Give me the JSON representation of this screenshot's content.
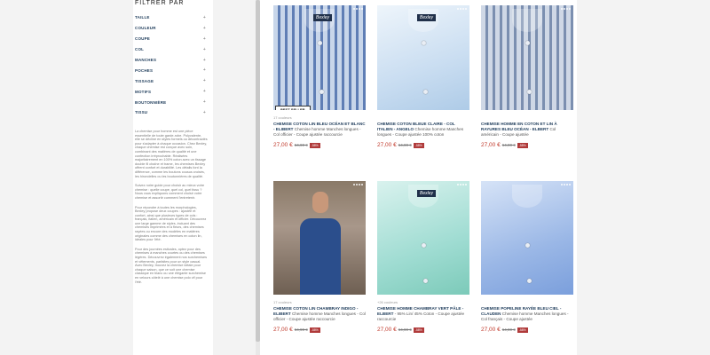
{
  "filters": {
    "title": "FILTRER PAR",
    "items": [
      "TAILLE",
      "COULEUR",
      "COUPE",
      "COL",
      "MANCHES",
      "POCHES",
      "TISSAGE",
      "MOTIFS",
      "BOUTONNIÈRE",
      "TISSU"
    ],
    "toggle_symbol": "+"
  },
  "description": [
    "La chemise pour homme est une pièce essentielle de toute garde-robe. Polyvalente, elle se décline en styles formels ou décontractés pour s'adapter à chaque occasion. Chez Bexley, chaque chemise est conçue avec soin, combinant des matières de qualité et une confection irréprochable. Réalisées majoritairement en 100% coton avec un tissage double fil chaîne et trame, les chemises Bexley offrent confort et durabilité. Les détails font la différence, comme les boutons cousus croisés, les hirondelles ou les boutonnières de qualité.",
    "Suivez notre guide pour choisir au mieux votre chemise : quelle coupe, quel col, quel tissu ? Nous vous expliquons comment choisir votre chemise et assortir comment l'entretenir.",
    "Pour répondre à toutes les morphologies, Bexley propose deux coupes : ajustée et confort, ainsi que plusieurs types de cols : français, italien, américain et officier. Découvrez une large gamme de styles, incluant des chemises imprimées et à fleurs, des chemises rayées ou encore des modèles en matières originales comme des chemises en coton lin, idéales pour l'été.",
    "Pour des journées estivales, optez pour des chemises à manches courtes ou des chemises légères. Découvrez également nos surchemises et vêtements, parfaites pour un style casual. Avec Bexley, trouvez la chemise idéale pour chaque saison, que ce soit une chemise classique en blanc ou une élégante surchemise en velours côtelé à une chemise polo vif pour l'été."
  ],
  "products": [
    {
      "colors": "17 couleurs",
      "badge": "BEST SELLER",
      "title": "CHEMISE COTON LIN BLEU OCÉAN ET BLANC - ELIBERT",
      "subtitle": "Chemise homme Manches longues - Col officier - Coupe ajustée raccourcie",
      "price": "27,00 €",
      "old_price": "64,90 €",
      "promo": "-58%",
      "brand": "Bexley",
      "image": "stripes-blue"
    },
    {
      "colors": "",
      "badge": "",
      "title": "CHEMISE COTON BLEUE CLAIRE - COL ITALIEN - ANGELO",
      "subtitle": "Chemise homme Manches longues - Coupe ajustée 100% coton",
      "price": "27,00 €",
      "old_price": "64,90 €",
      "promo": "-58%",
      "brand": "Bexley",
      "image": "solid-light"
    },
    {
      "colors": "",
      "badge": "",
      "title": "CHEMISE HOMME EN COTON ET LIN À RAYURES BLEU OCÉAN - ELBERT",
      "subtitle": "Col américain - Coupe ajustée",
      "price": "27,00 €",
      "old_price": "64,90 €",
      "promo": "-58%",
      "brand": "",
      "image": "stripes-grey"
    },
    {
      "colors": "17 couleurs",
      "badge": "",
      "title": "CHEMISE COTON LIN CHAMBRAY INDIGO - ELIBERT",
      "subtitle": "Chemise homme Manches longues - Col officier - Coupe ajustée raccourcie",
      "price": "27,00 €",
      "old_price": "64,90 €",
      "promo": "-58%",
      "brand": "",
      "image": "model"
    },
    {
      "colors": "+26 couleurs",
      "badge": "",
      "title": "CHEMISE HOMME CHAMBRAY VERT PÂLE - ELBERT",
      "subtitle": "- 95% Lin/ 45% Coton - Coupe ajustée raccourcie",
      "price": "27,00 €",
      "old_price": "64,90 €",
      "promo": "-58%",
      "brand": "Bexley",
      "image": "solid-mint"
    },
    {
      "colors": "",
      "badge": "",
      "title": "CHEMISE POPELINE RAYÉE BLEU CIEL - CLAUDEN",
      "subtitle": "Chemise homme Manches longues - Col français - Coupe ajustée",
      "price": "27,00 €",
      "old_price": "64,90 €",
      "promo": "-58%",
      "brand": "",
      "image": "solid-blue"
    }
  ]
}
